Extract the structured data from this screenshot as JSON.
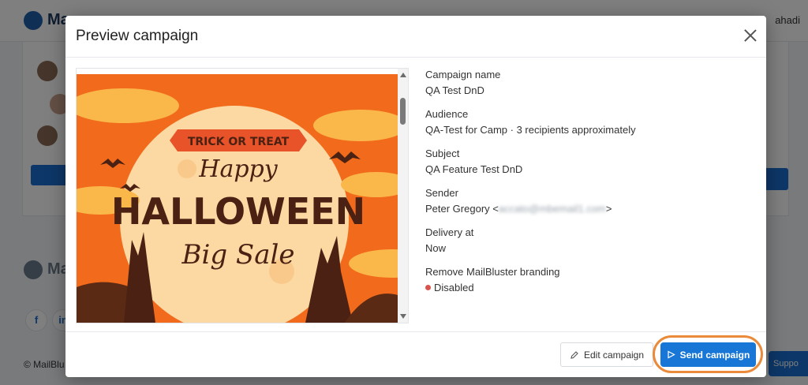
{
  "background": {
    "brand_name": "Ma",
    "user_name": "ahadi",
    "footer_brand": "Ma",
    "social": [
      "f",
      "in"
    ],
    "copyright": "© MailBlu",
    "support_label": "Suppo"
  },
  "modal": {
    "title": "Preview campaign",
    "preview": {
      "banner_text": "TRICK OR TREAT",
      "headline_1": "Happy",
      "headline_2": "HALLOWEEN",
      "headline_3": "Big Sale"
    },
    "details": [
      {
        "label": "Campaign name",
        "value": "QA Test DnD"
      },
      {
        "label": "Audience",
        "value": "QA-Test for Camp · 3 recipients approximately"
      },
      {
        "label": "Subject",
        "value": "QA Feature Test DnD"
      },
      {
        "label": "Sender",
        "value_prefix": "Peter Gregory <",
        "value_blurred": "accato@mbemail1.com",
        "value_suffix": ">"
      },
      {
        "label": "Delivery at",
        "value": "Now"
      },
      {
        "label": "Remove MailBluster branding",
        "value": "Disabled",
        "status_color": "#d9534f"
      }
    ],
    "footer": {
      "edit_label": "Edit campaign",
      "send_label": "Send campaign"
    }
  },
  "colors": {
    "primary": "#1877d6",
    "highlight": "#e98b3a",
    "overlay": "rgba(0,0,0,0.5)"
  }
}
